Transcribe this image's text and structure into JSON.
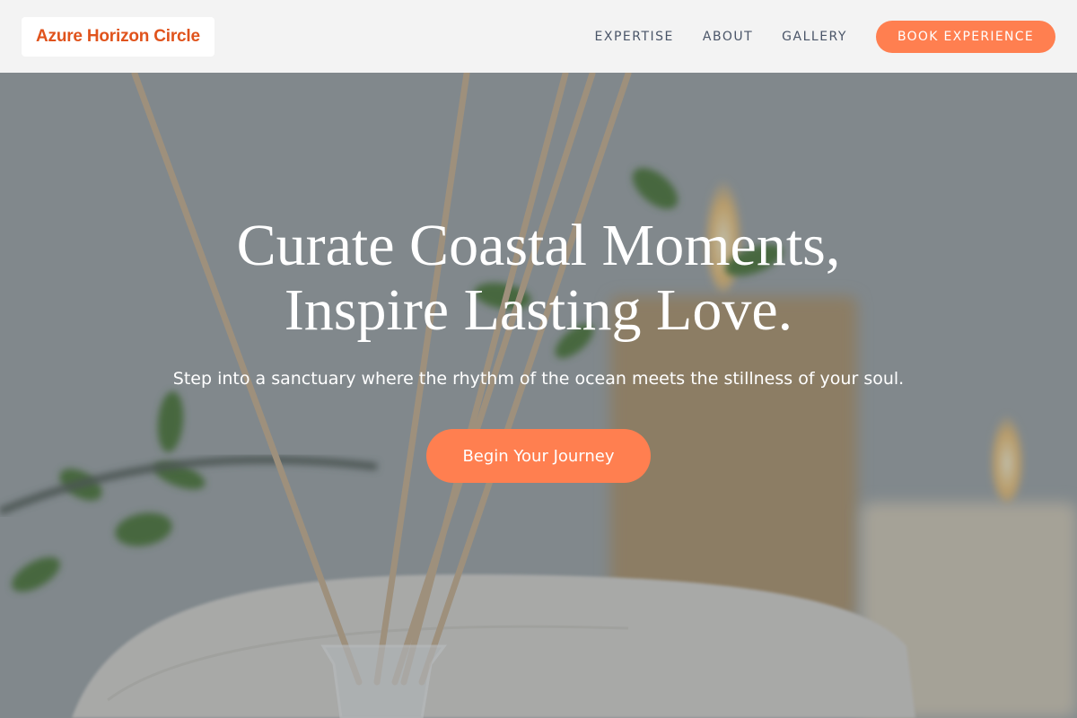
{
  "header": {
    "logo_text": "Azure Horizon Circle",
    "nav": [
      {
        "label": "EXPERTISE"
      },
      {
        "label": "ABOUT"
      },
      {
        "label": "GALLERY"
      }
    ],
    "book_label": "BOOK EXPERIENCE"
  },
  "hero": {
    "title_line1": "Curate Coastal Moments,",
    "title_line2": "Inspire Lasting Love.",
    "subtitle": "Step into a sanctuary where the rhythm of the ocean meets the stillness of your soul.",
    "cta_label": "Begin Your Journey",
    "background_scene": "spa-reed-diffuser-candles-towel-photo"
  },
  "colors": {
    "accent": "#ff7f50",
    "logo_text": "#e0531c",
    "header_bg": "#f3f3f3",
    "nav_text": "#4a5568"
  }
}
